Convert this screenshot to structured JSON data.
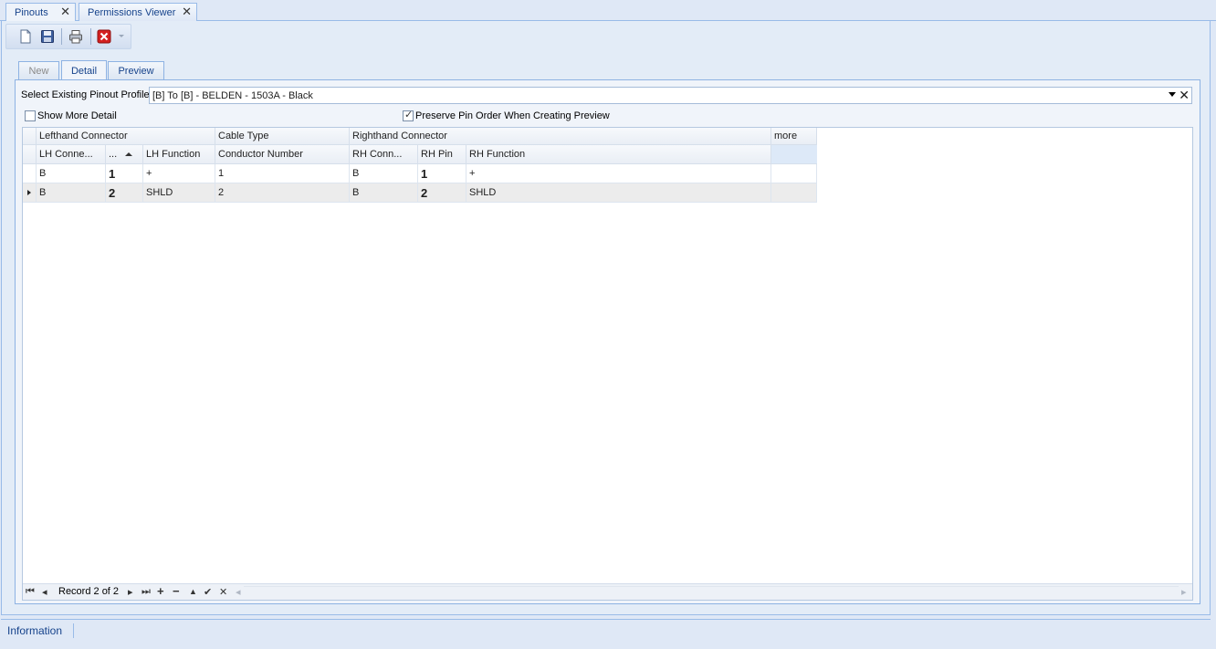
{
  "doc_tabs": [
    {
      "label": "Pinouts"
    },
    {
      "label": "Permissions Viewer"
    }
  ],
  "inner_tabs": [
    {
      "label": "New"
    },
    {
      "label": "Detail"
    },
    {
      "label": "Preview"
    }
  ],
  "profile": {
    "label": "Select Existing Pinout Profile",
    "value": "[B] To [B] - BELDEN - 1503A - Black"
  },
  "options": {
    "show_more_detail": "Show More Detail",
    "show_more_detail_checked": false,
    "preserve_pin_order": "Preserve Pin Order When Creating Preview",
    "preserve_pin_order_checked": true
  },
  "grid": {
    "band_headers": {
      "lefthand": "Lefthand Connector",
      "cable": "Cable Type",
      "righthand": "Righthand Connector",
      "more": "more"
    },
    "columns": {
      "lh_conn": "LH Conne...",
      "lh_pin": "...",
      "lh_function": "LH Function",
      "conductor": "Conductor Number",
      "rh_conn": "RH Conn...",
      "rh_pin": "RH Pin",
      "rh_function": "RH Function"
    },
    "rows": [
      {
        "lh_conn": "B",
        "lh_pin": "1",
        "lh_function": "+",
        "conductor": "1",
        "rh_conn": "B",
        "rh_pin": "1",
        "rh_function": "+"
      },
      {
        "lh_conn": "B",
        "lh_pin": "2",
        "lh_function": "SHLD",
        "conductor": "2",
        "rh_conn": "B",
        "rh_pin": "2",
        "rh_function": "SHLD"
      }
    ],
    "record_text": "Record 2 of 2"
  },
  "status_bar": {
    "label": "Information"
  }
}
